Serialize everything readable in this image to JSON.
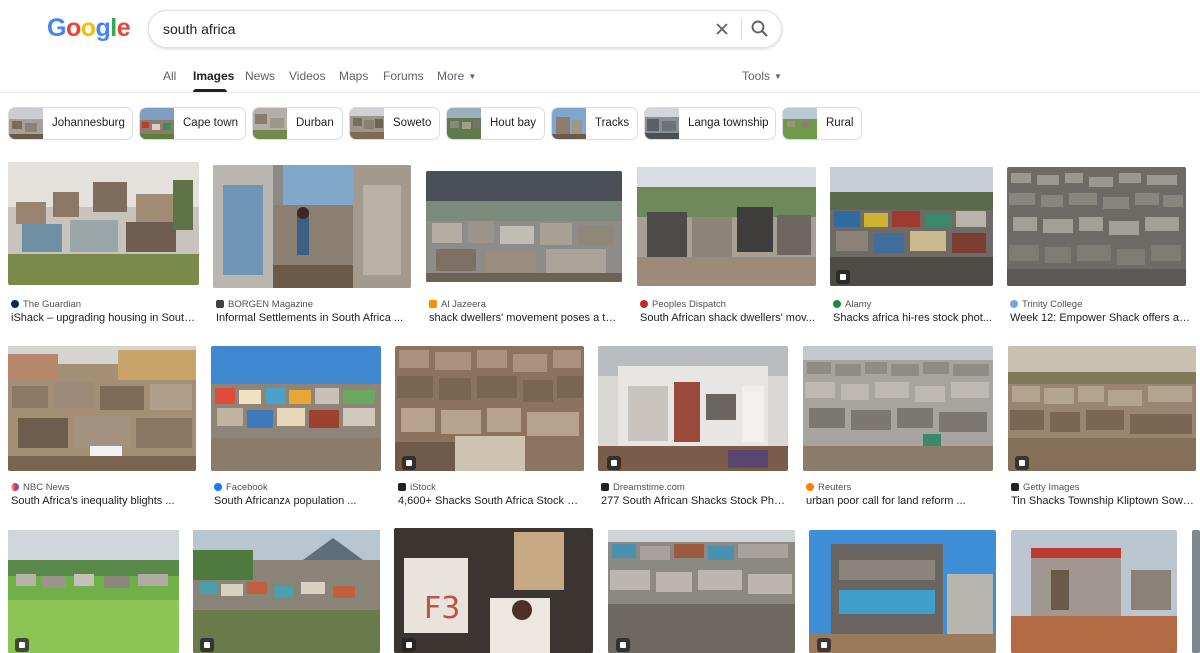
{
  "search": {
    "query": "south africa"
  },
  "tabs": [
    {
      "label": "All"
    },
    {
      "label": "Images"
    },
    {
      "label": "News"
    },
    {
      "label": "Videos"
    },
    {
      "label": "Maps"
    },
    {
      "label": "Forums"
    },
    {
      "label": "More"
    },
    {
      "label": "Tools"
    }
  ],
  "chips": [
    {
      "label": "Johannesburg"
    },
    {
      "label": "Cape town"
    },
    {
      "label": "Durban"
    },
    {
      "label": "Soweto"
    },
    {
      "label": "Hout bay"
    },
    {
      "label": "Tracks"
    },
    {
      "label": "Langa township"
    },
    {
      "label": "Rural"
    }
  ],
  "colors": {
    "brand_blue": "#4285f4",
    "brand_red": "#ea4335",
    "brand_yellow": "#fbbc05",
    "brand_green": "#34a853"
  },
  "results": [
    {
      "source": "The Guardian",
      "title": "iShack – upgrading housing in South ..."
    },
    {
      "source": "BORGEN Magazine",
      "title": "Informal Settlements in South Africa ..."
    },
    {
      "source": "Al Jazeera",
      "title": "shack dwellers' movement poses a thr..."
    },
    {
      "source": "Peoples Dispatch",
      "title": "South African shack dwellers' mov..."
    },
    {
      "source": "Alamy",
      "title": "Shacks africa hi-res stock phot..."
    },
    {
      "source": "Trinity College",
      "title": "Week 12: Empower Shack offers a ..."
    },
    {
      "source": "NBC News",
      "title": "South Africa's inequality blights ..."
    },
    {
      "source": "Facebook",
      "title": "South Africanᴢᴀ population ..."
    },
    {
      "source": "iStock",
      "title": "4,600+ Shacks South Africa Stock Ph..."
    },
    {
      "source": "Dreamstime.com",
      "title": "277 South African Shacks Stock Phot..."
    },
    {
      "source": "Reuters",
      "title": "urban poor call for land reform ..."
    },
    {
      "source": "Getty Images",
      "title": "Tin Shacks Township Kliptown Sowe..."
    }
  ]
}
